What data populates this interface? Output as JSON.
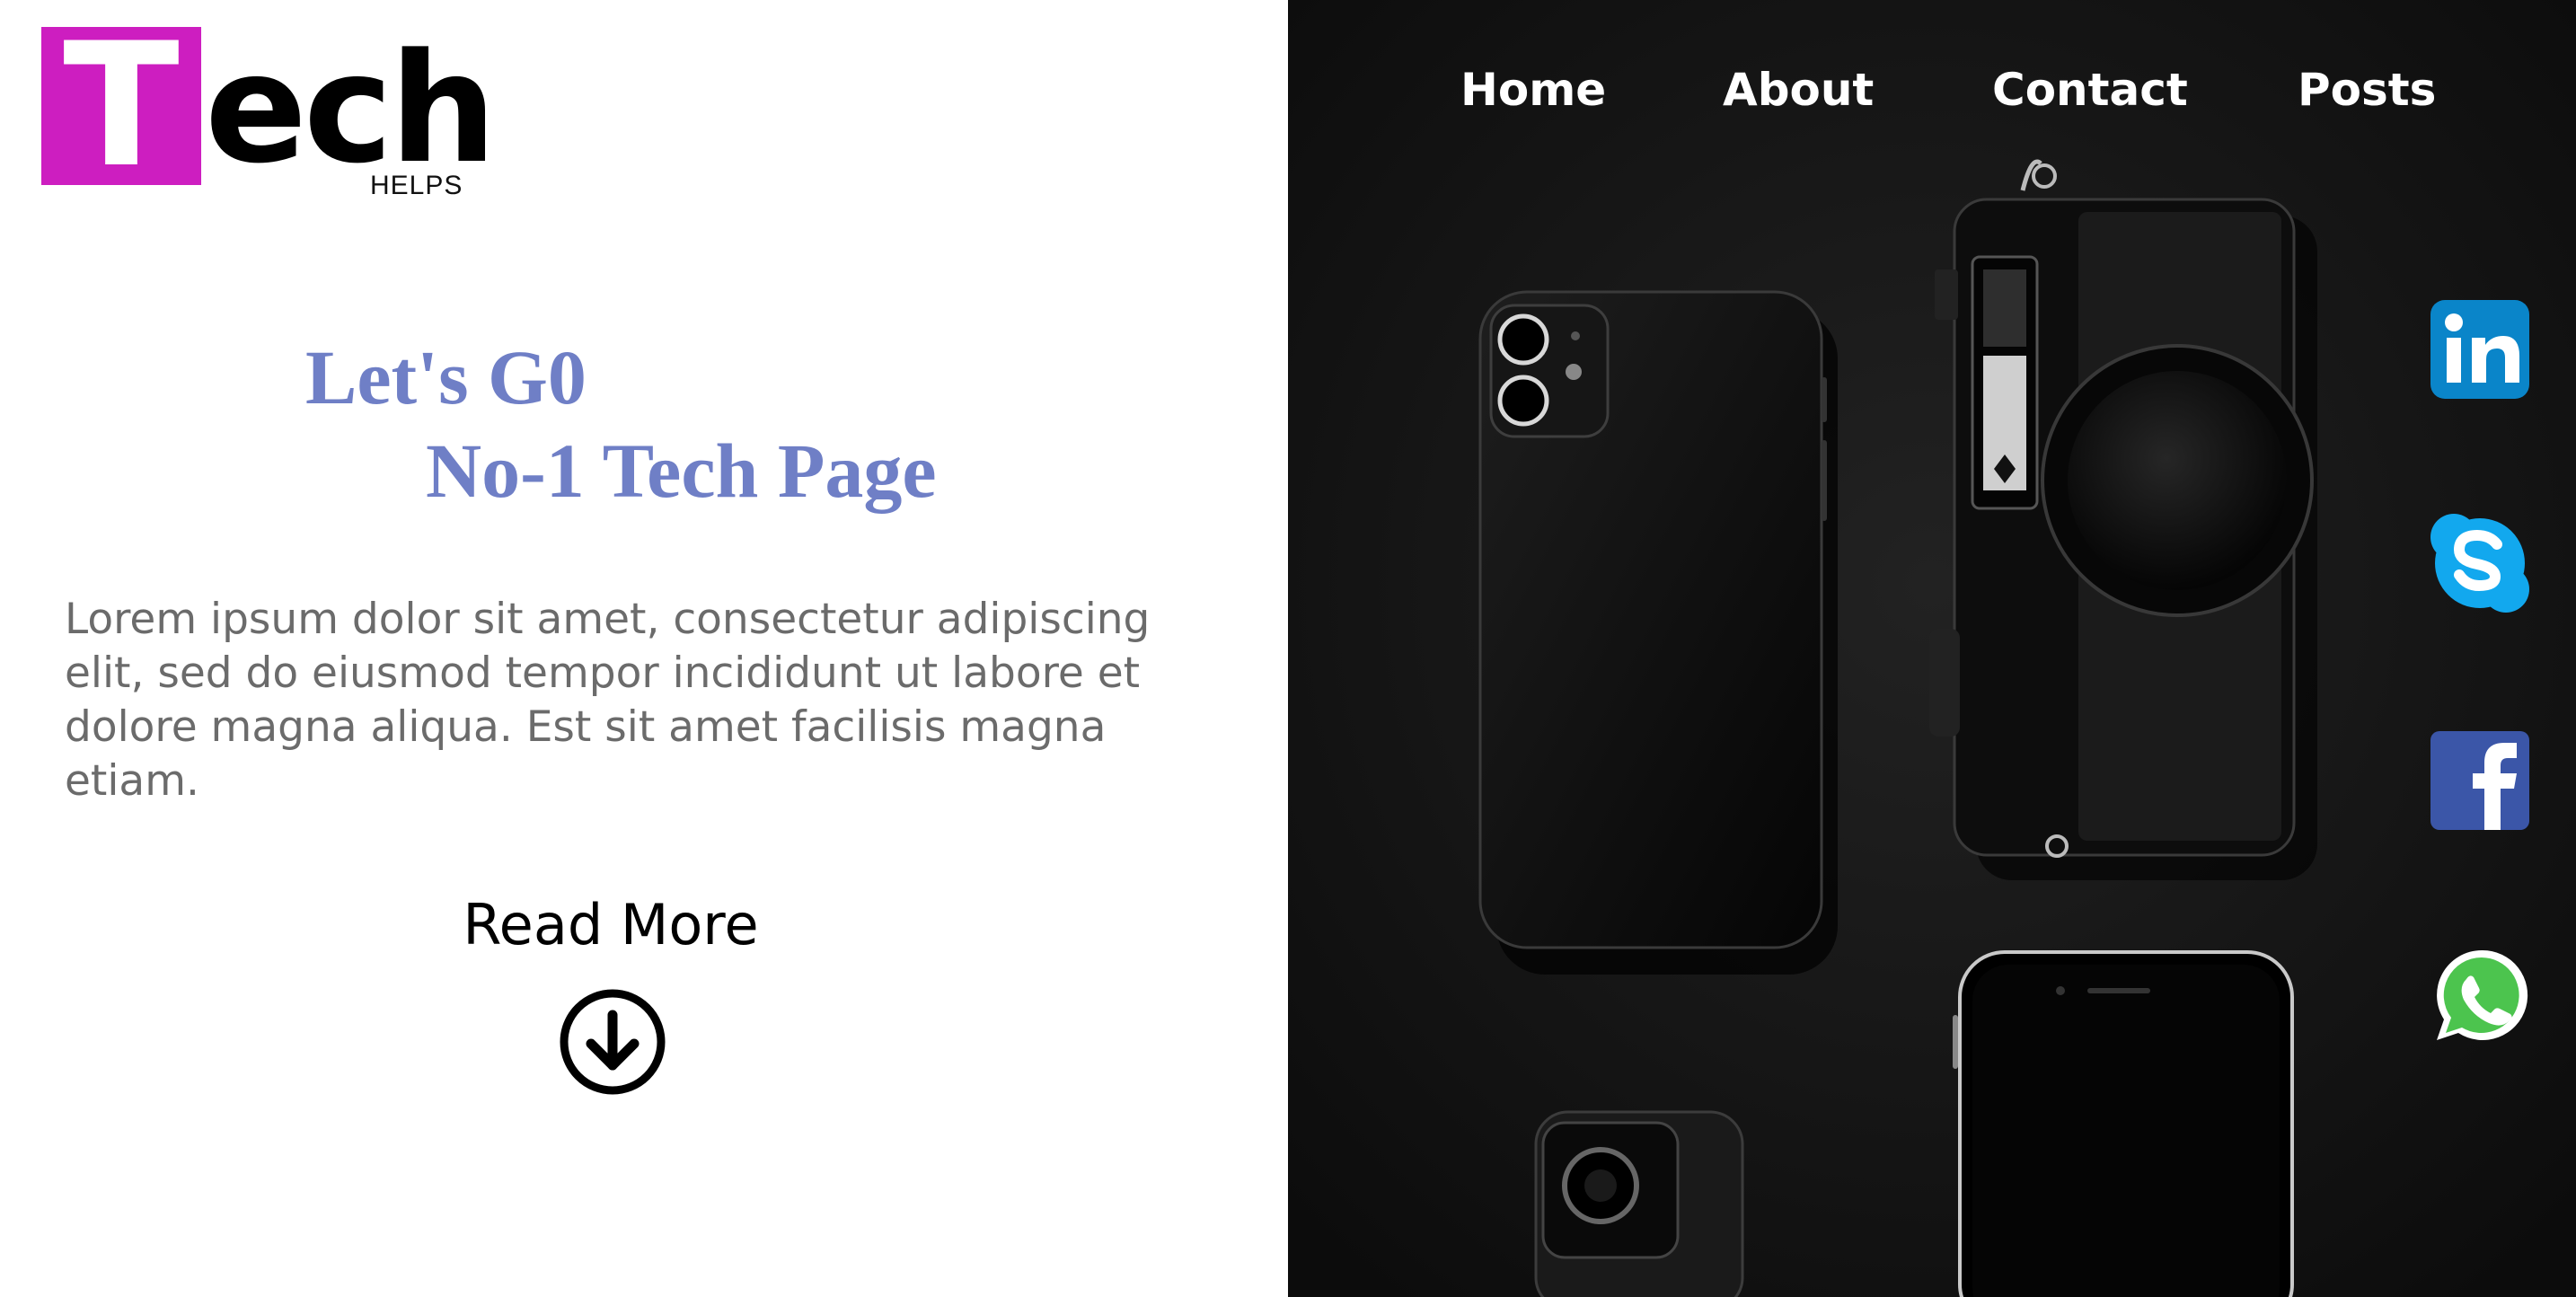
{
  "logo": {
    "letter": "T",
    "rest": "ech",
    "tagline": "HELPS"
  },
  "hero": {
    "line1": "Let's G0",
    "line2": "No-1 Tech Page",
    "body": "Lorem ipsum dolor sit amet, consectetur adipiscing elit, sed do eiusmod tempor incididunt ut labore et dolore magna aliqua. Est sit amet facilisis magna etiam.",
    "read_more": "Read More"
  },
  "nav": {
    "items": [
      {
        "label": "Home"
      },
      {
        "label": "About"
      },
      {
        "label": "Contact"
      },
      {
        "label": "Posts"
      }
    ]
  },
  "social": {
    "icons": [
      "linkedin-icon",
      "skype-icon",
      "facebook-icon",
      "whatsapp-icon"
    ]
  },
  "colors": {
    "logo_accent": "#cd1ec0",
    "heading": "#6f7fc6",
    "body_text": "#6b6b6b",
    "hero_background": "#141414",
    "linkedin": "#0a85c9",
    "skype": "#12a8ee",
    "facebook": "#3b56a8",
    "whatsapp": "#4cc44e"
  }
}
